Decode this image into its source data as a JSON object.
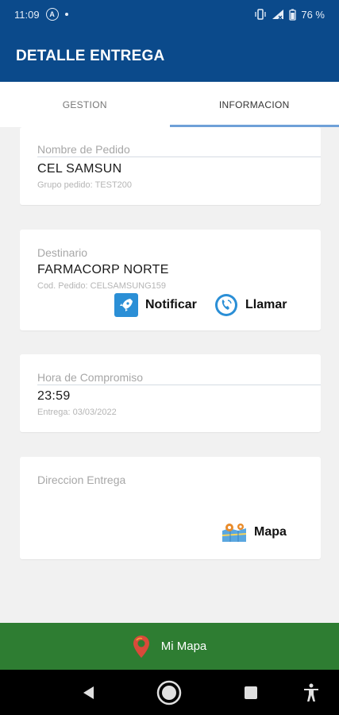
{
  "status": {
    "time": "11:09",
    "battery": "76 %"
  },
  "app": {
    "title": "DETALLE ENTREGA"
  },
  "tabs": [
    {
      "label": "GESTION"
    },
    {
      "label": "INFORMACION"
    }
  ],
  "pedido": {
    "label": "Nombre de Pedido",
    "value": "CEL SAMSUN",
    "sub": "Grupo pedido: TEST200"
  },
  "destino": {
    "label": "Destinario",
    "value": "FARMACORP NORTE",
    "sub": "Cod. Pedido: CELSAMSUNG159",
    "notify_label": "Notificar",
    "call_label": "Llamar"
  },
  "hora": {
    "label": "Hora de Compromiso",
    "value": "23:59",
    "sub": "Entrega: 03/03/2022"
  },
  "direccion": {
    "label": "Direccion Entrega",
    "map_label": "Mapa"
  },
  "bottom": {
    "label": "Mi Mapa"
  },
  "colors": {
    "app_bar": "#0b4a8b",
    "tab_indicator": "#6fa0d8",
    "bottom_button": "#2e7d32",
    "notify_icon": "#2b8fd6"
  }
}
